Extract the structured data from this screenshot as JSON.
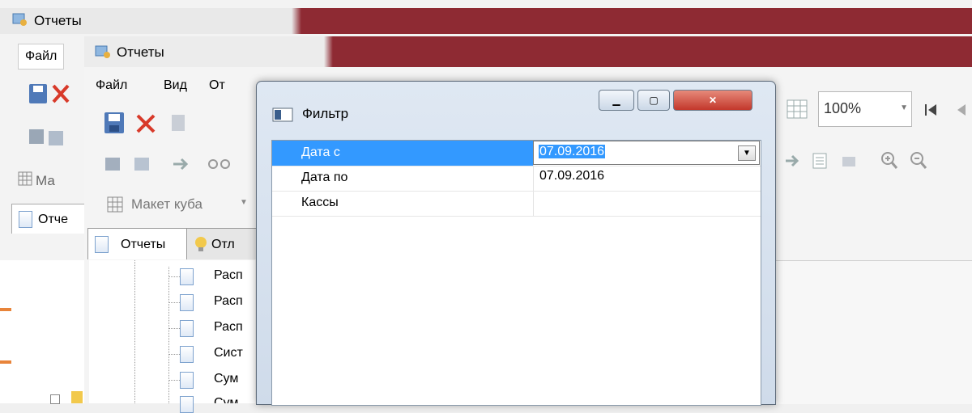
{
  "back_window": {
    "title": "Отчеты",
    "menu_file": "Файл",
    "toolbar_label_layout": "Ма",
    "tab_reports": "Отче"
  },
  "front_window": {
    "title": "Отчеты",
    "menu": [
      "Файл",
      "Вид",
      "От"
    ],
    "toolbar_label_layout": "Макет куба",
    "tabs": [
      {
        "label": "Отчеты"
      },
      {
        "label": "Отл"
      }
    ],
    "tree_items": [
      "Расп",
      "Расп",
      "Расп",
      "Сист",
      "Сум",
      "Сум"
    ]
  },
  "dialog": {
    "title": "Фильтр",
    "rows": [
      {
        "name": "Дата с",
        "value": "07.09.2016",
        "selected": true
      },
      {
        "name": "Дата по",
        "value": "07.09.2016",
        "selected": false
      },
      {
        "name": "Кассы",
        "value": "",
        "selected": false
      }
    ]
  },
  "toolbar_right": {
    "zoom": "100%"
  },
  "colors": {
    "accent_red": "#8e2a33",
    "selection_blue": "#3399ff",
    "orange": "#e8843a"
  }
}
